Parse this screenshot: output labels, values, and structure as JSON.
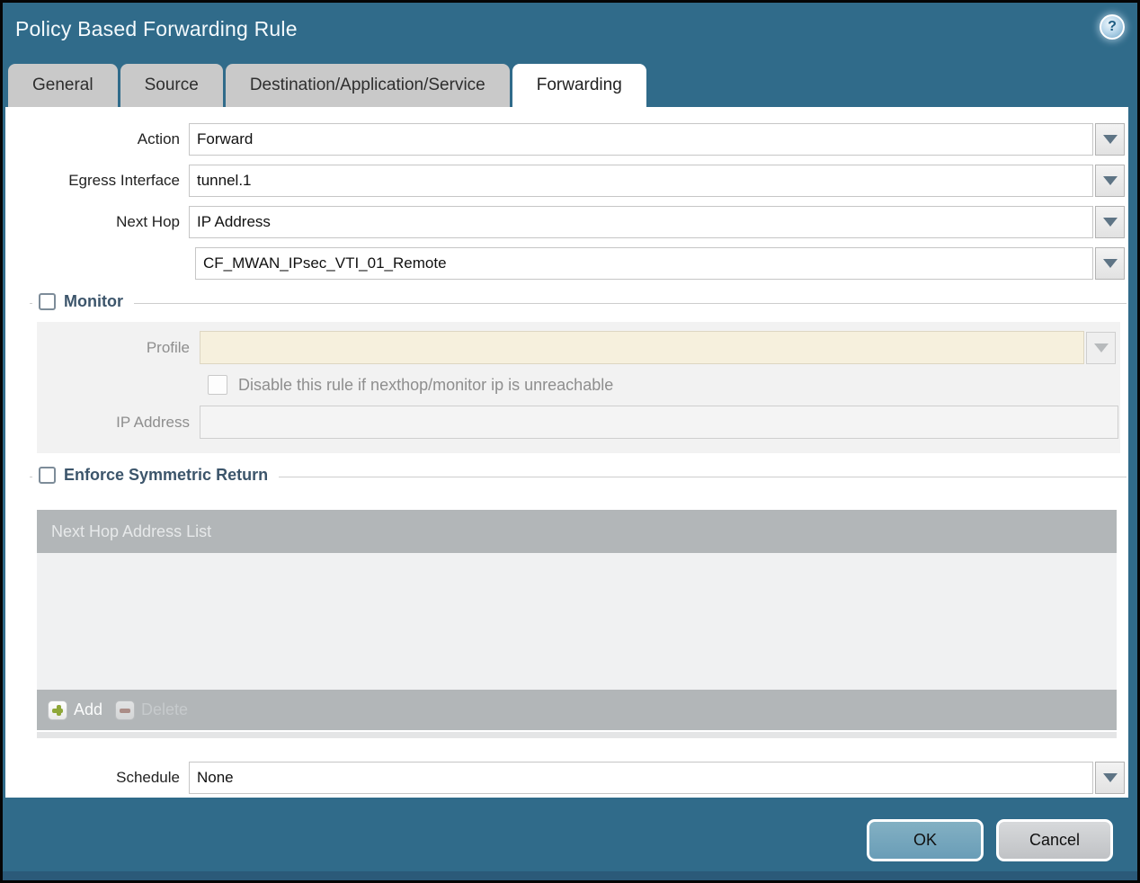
{
  "window": {
    "title": "Policy Based Forwarding Rule",
    "help_icon": {
      "name": "help-icon",
      "glyph": "?"
    }
  },
  "tabs": [
    {
      "label": "General",
      "active": false
    },
    {
      "label": "Source",
      "active": false
    },
    {
      "label": "Destination/Application/Service",
      "active": false
    },
    {
      "label": "Forwarding",
      "active": true
    }
  ],
  "form": {
    "action": {
      "label": "Action",
      "value": "Forward"
    },
    "egress_interface": {
      "label": "Egress Interface",
      "value": "tunnel.1"
    },
    "next_hop": {
      "label": "Next Hop",
      "type_value": "IP Address",
      "address_value": "CF_MWAN_IPsec_VTI_01_Remote"
    },
    "schedule": {
      "label": "Schedule",
      "value": "None"
    }
  },
  "monitor": {
    "title": "Monitor",
    "checked": false,
    "profile": {
      "label": "Profile",
      "value": ""
    },
    "disable_rule": {
      "label": "Disable this rule if nexthop/monitor ip is unreachable",
      "checked": false
    },
    "ip_address": {
      "label": "IP Address",
      "value": ""
    }
  },
  "enforce_symmetric_return": {
    "title": "Enforce Symmetric Return",
    "checked": false,
    "grid": {
      "column_header": "Next Hop Address List",
      "rows": [],
      "add_button": "Add",
      "delete_button": "Delete",
      "delete_disabled": true
    }
  },
  "footer": {
    "ok_button": "OK",
    "cancel_button": "Cancel"
  },
  "icons": [
    "help-icon",
    "dropdown-arrow-icon",
    "add-plus-icon",
    "delete-minus-icon"
  ],
  "colors": {
    "titlebar_teal": "#306b8a",
    "bottom_strip_blue": "#2b5a79",
    "inactive_tab_gray": "#c9c9c9",
    "grid_bar_gray": "#b2b6b8",
    "grid_body_gray": "#f0f1f2",
    "disabled_field_beige": "#f6f0dd",
    "legend_text_slate": "#3c556b",
    "ok_button_blue": "#74a6be",
    "cancel_button_gray": "#c9cbce"
  }
}
